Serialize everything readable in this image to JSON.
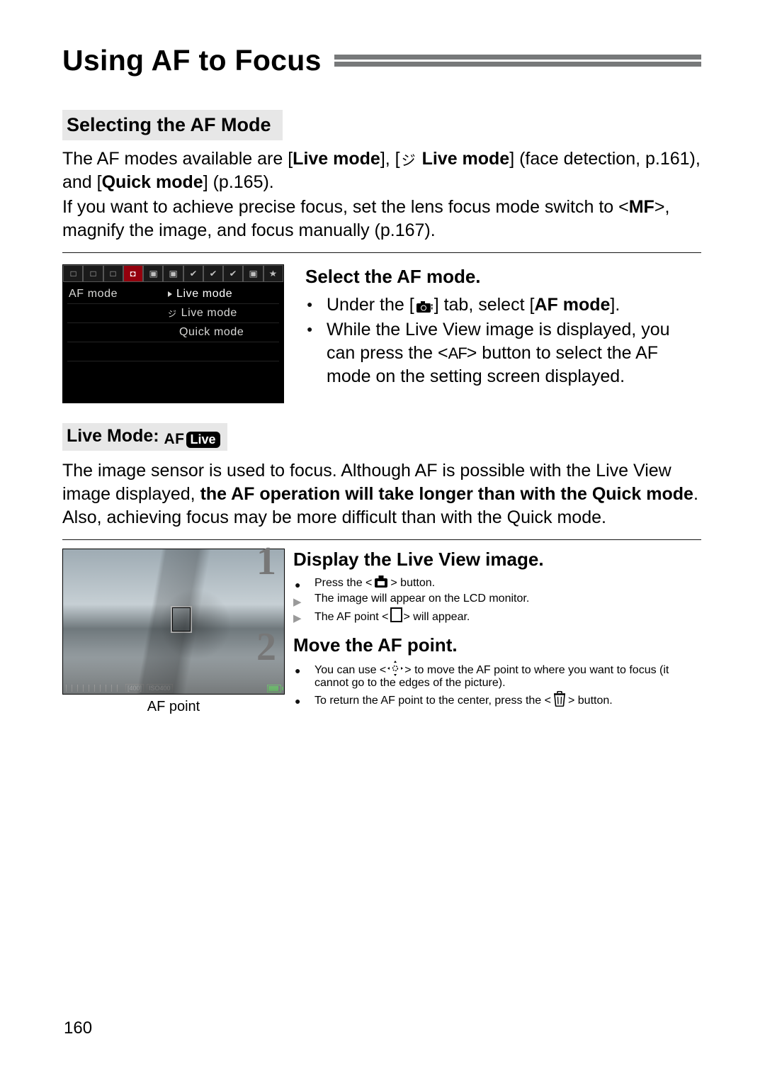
{
  "header": {
    "title": "Using AF to Focus"
  },
  "section1": {
    "label": "Selecting the AF Mode",
    "para1_a": "The AF modes available are [",
    "para1_b": "Live mode",
    "para1_c": "], [",
    "para1_d": " Live mode",
    "para1_e": "] (face detection, p.161), and [",
    "para1_f": "Quick mode",
    "para1_g": "] (p.165).",
    "para2_a": "If you want to achieve precise focus, set the lens focus mode switch to <",
    "para2_b": "MF",
    "para2_c": ">, magnify the image, and focus manually (p.167)."
  },
  "menu": {
    "item_label": "AF mode",
    "options": [
      "Live mode",
      "Live mode",
      "Quick mode"
    ]
  },
  "select_af": {
    "heading": "Select the AF mode.",
    "b1_a": "Under the [",
    "b1_b": "] tab, select [",
    "b1_c": "AF mode",
    "b1_d": "].",
    "b2_a": "While the Live View image is displayed, you can press the <",
    "b2_b": "> button to select the AF mode on the setting screen displayed."
  },
  "livemode": {
    "label_a": "Live Mode: ",
    "badge_pre": "AF",
    "badge_pill": "Live",
    "para_a": "The image sensor is used to focus. Although AF is possible with the Live View image displayed, ",
    "para_b": "the AF operation will take longer than with the Quick mode",
    "para_c": ". Also, achieving focus may be more difficult than with the Quick mode."
  },
  "osd": {
    "shots": "[400]",
    "iso": "ISO400"
  },
  "caption_afpoint": "AF point",
  "step1": {
    "num": "1",
    "heading": "Display the Live View image.",
    "b1_a": "Press the <",
    "b1_b": "> button.",
    "r1": "The image will appear on the LCD monitor.",
    "r2_a": "The AF point <",
    "r2_b": "> will appear."
  },
  "step2": {
    "num": "2",
    "heading": "Move the AF point.",
    "b1_a": "You can use <",
    "b1_b": "> to move the AF point to where you want to focus (it cannot go to the edges of the picture).",
    "b2_a": "To return the AF point to the center, press the <",
    "b2_b": "> button."
  },
  "page_number": "160",
  "af_text": "AF"
}
